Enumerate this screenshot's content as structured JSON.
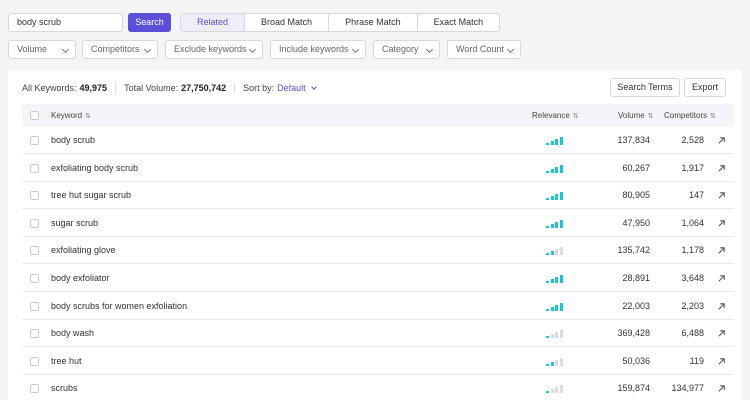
{
  "search": {
    "query": "body scrub",
    "button_label": "Search",
    "tabs": [
      {
        "label": "Related",
        "active": true
      },
      {
        "label": "Broad Match",
        "active": false
      },
      {
        "label": "Phrase Match",
        "active": false
      },
      {
        "label": "Exact Match",
        "active": false
      }
    ]
  },
  "filters": [
    "Volume",
    "Competitors",
    "Exclude keywords",
    "Include keywords",
    "Category",
    "Word Count"
  ],
  "summary": {
    "all_keywords_label": "All Keywords:",
    "all_keywords_value": "49,975",
    "total_volume_label": "Total Volume:",
    "total_volume_value": "27,750,742",
    "sort_label": "Sort by:",
    "sort_value": "Default"
  },
  "actions": {
    "search_terms": "Search Terms",
    "export": "Export"
  },
  "table": {
    "columns": {
      "keyword": "Keyword",
      "relevance": "Relevance",
      "volume": "Volume",
      "competitors": "Competitors"
    },
    "rows": [
      {
        "keyword": "body scrub",
        "relevance": 4,
        "volume": "137,834",
        "competitors": "2,528"
      },
      {
        "keyword": "exfoliating body scrub",
        "relevance": 4,
        "volume": "60,267",
        "competitors": "1,917"
      },
      {
        "keyword": "tree hut sugar scrub",
        "relevance": 4,
        "volume": "80,905",
        "competitors": "147"
      },
      {
        "keyword": "sugar scrub",
        "relevance": 4,
        "volume": "47,950",
        "competitors": "1,064"
      },
      {
        "keyword": "exfoliating glove",
        "relevance": 2,
        "volume": "135,742",
        "competitors": "1,178"
      },
      {
        "keyword": "body exfoliator",
        "relevance": 4,
        "volume": "28,891",
        "competitors": "3,648"
      },
      {
        "keyword": "body scrubs for women exfoliation",
        "relevance": 4,
        "volume": "22,003",
        "competitors": "2,203"
      },
      {
        "keyword": "body wash",
        "relevance": 1,
        "volume": "369,428",
        "competitors": "6,488"
      },
      {
        "keyword": "tree hut",
        "relevance": 2,
        "volume": "50,036",
        "competitors": "119"
      },
      {
        "keyword": "scrubs",
        "relevance": 1,
        "volume": "159,874",
        "competitors": "134,977"
      }
    ]
  },
  "colors": {
    "accent": "#5a4fd6",
    "relevance_on": "#1fc3d6",
    "relevance_off": "#d9dde3"
  }
}
